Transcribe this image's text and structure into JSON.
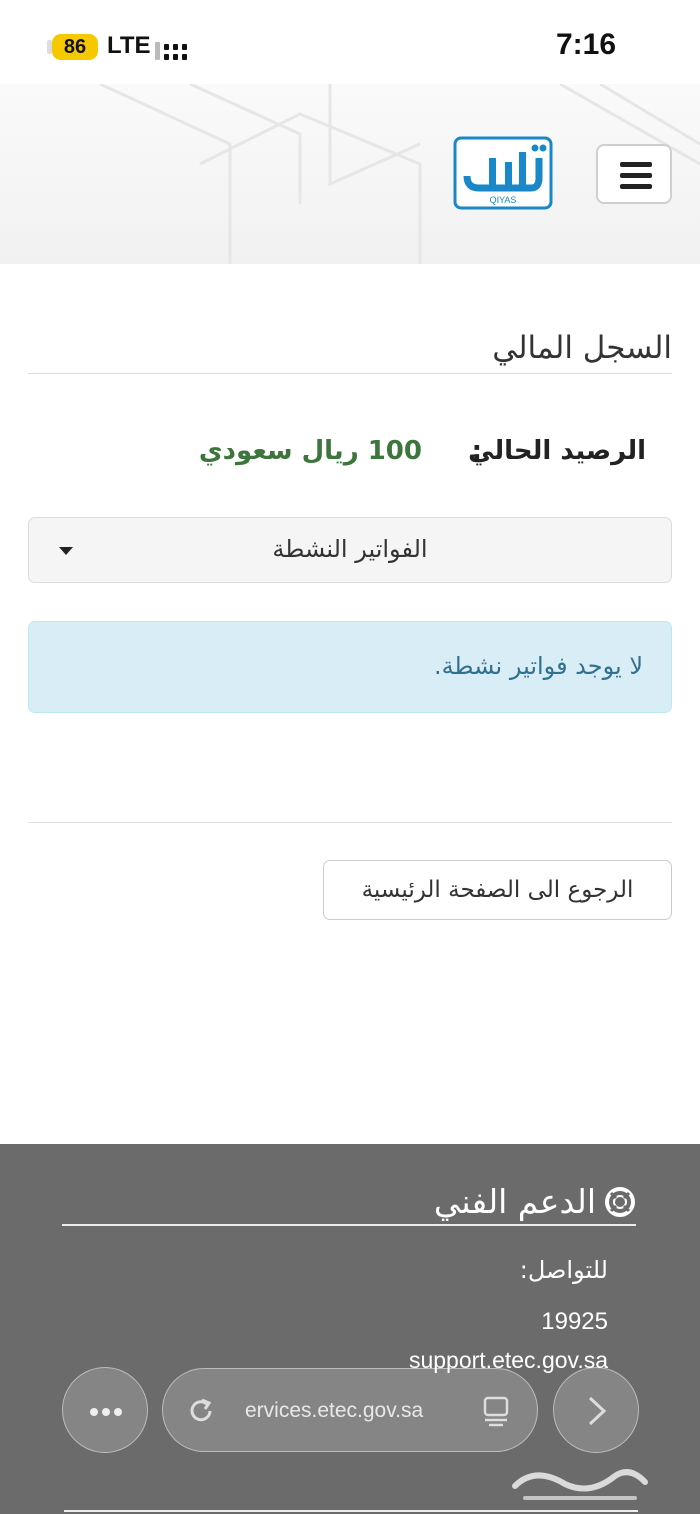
{
  "status_bar": {
    "battery": "86",
    "network": "LTE",
    "time": "7:16"
  },
  "header": {
    "logo_text": "QIYAS",
    "menu_icon": "hamburger-menu-icon"
  },
  "main": {
    "title": "السجل المالي",
    "balance": {
      "label": "الرصيد الحالي",
      "separator": ":",
      "value": "100 ريال سعودي",
      "value_color": "#3c763d"
    },
    "invoices_dropdown": {
      "label": "الفواتير النشطة"
    },
    "alert": {
      "text": "لا يوجد فواتير نشطة.",
      "background": "#d9edf7"
    },
    "back_button": "الرجوع الى الصفحة الرئيسية"
  },
  "footer": {
    "title": "الدعم الفني",
    "contact_label": "للتواصل:",
    "phone": "19925",
    "email": "support.etec.gov.sa",
    "background": "#6b6b6b"
  },
  "browser": {
    "url": "ervices.etec.gov.sa"
  }
}
